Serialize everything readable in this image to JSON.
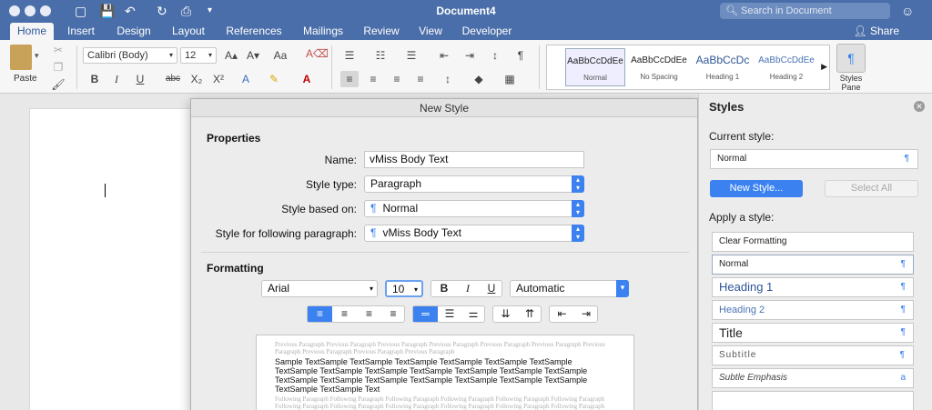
{
  "app": {
    "title": "Document4",
    "search_placeholder": "Search in Document",
    "share_label": "Share"
  },
  "tabs": [
    "Home",
    "Insert",
    "Design",
    "Layout",
    "References",
    "Mailings",
    "Review",
    "View",
    "Developer"
  ],
  "ribbon": {
    "paste_label": "Paste",
    "font_name": "Calibri (Body)",
    "font_size": "12",
    "style_gallery": [
      {
        "preview": "AaBbCcDdEe",
        "name": "Normal"
      },
      {
        "preview": "AaBbCcDdEe",
        "name": "No Spacing"
      },
      {
        "preview": "AaBbCcDc",
        "name": "Heading 1"
      },
      {
        "preview": "AaBbCcDdEe",
        "name": "Heading 2"
      }
    ],
    "styles_pane_label_line1": "Styles",
    "styles_pane_label_line2": "Pane"
  },
  "dialog": {
    "title": "New Style",
    "properties_heading": "Properties",
    "name_label": "Name:",
    "name_value": "vMiss Body Text",
    "style_type_label": "Style type:",
    "style_type_value": "Paragraph",
    "based_on_label": "Style based on:",
    "based_on_value": "Normal",
    "following_label": "Style for following paragraph:",
    "following_value": "vMiss Body Text",
    "formatting_heading": "Formatting",
    "font_value": "Arial",
    "size_value": "10",
    "color_value": "Automatic",
    "preview_previous": "Previous Paragraph Previous Paragraph Previous Paragraph Previous Paragraph Previous Paragraph Previous Paragraph Previous Paragraph Previous Paragraph Previous Paragraph Previous Paragraph",
    "preview_sample": "Sample TextSample TextSample TextSample TextSample TextSample TextSample TextSample TextSample TextSample TextSample TextSample TextSample TextSample TextSample TextSample TextSample TextSample TextSample TextSample TextSample TextSample TextSample Text",
    "preview_following": "Following Paragraph Following Paragraph Following Paragraph Following Paragraph Following Paragraph Following Paragraph Following Paragraph Following Paragraph Following Paragraph Following Paragraph Following Paragraph Following Paragraph Following Paragraph Following Paragraph Following Paragraph Following Paragraph"
  },
  "styles_pane": {
    "title": "Styles",
    "current_label": "Current style:",
    "current_value": "Normal",
    "new_style_button": "New Style...",
    "select_all_button": "Select All",
    "apply_label": "Apply a style:",
    "styles": [
      {
        "name": "Clear Formatting",
        "mark": ""
      },
      {
        "name": "Normal",
        "mark": "¶"
      },
      {
        "name": "Heading 1",
        "mark": "¶"
      },
      {
        "name": "Heading 2",
        "mark": "¶"
      },
      {
        "name": "Title",
        "mark": "¶"
      },
      {
        "name": "Subtitle",
        "mark": "¶"
      },
      {
        "name": "Subtle Emphasis",
        "mark": "a"
      }
    ]
  },
  "colors": {
    "title_bar": "#4a6ea9",
    "accent_blue": "#3b82f0"
  }
}
